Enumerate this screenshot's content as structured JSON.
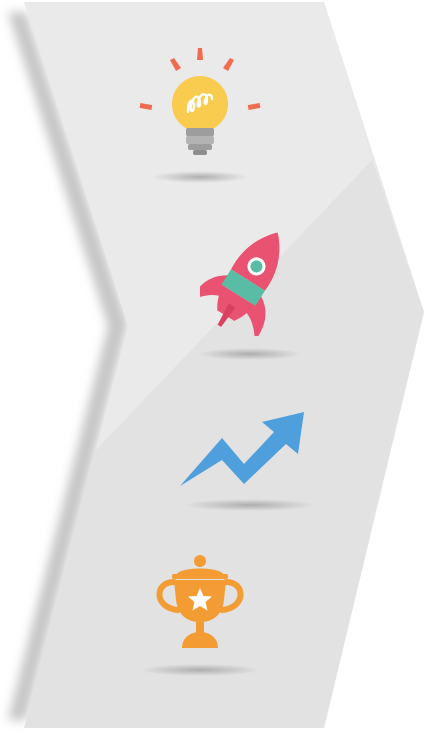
{
  "colors": {
    "page_background": "#ffffff",
    "chevron_fill_top": "#e9e9e9",
    "chevron_fill_bottom": "#e4e4e4",
    "chevron_highlight": "#f1f1f1",
    "bulb_glass": "#f9cb4e",
    "bulb_base": "#a5a5a5",
    "bulb_rays": "#ef6c4e",
    "rocket_body": "#ea5271",
    "rocket_band": "#59bca5",
    "arrow_blue": "#4f9fdd",
    "trophy_orange": "#f39c33",
    "star_white": "#ffffff"
  },
  "icons": [
    {
      "name": "lightbulb-icon",
      "meaning": "idea"
    },
    {
      "name": "rocket-icon",
      "meaning": "launch"
    },
    {
      "name": "trend-arrow-icon",
      "meaning": "growth"
    },
    {
      "name": "trophy-icon",
      "meaning": "success"
    }
  ]
}
